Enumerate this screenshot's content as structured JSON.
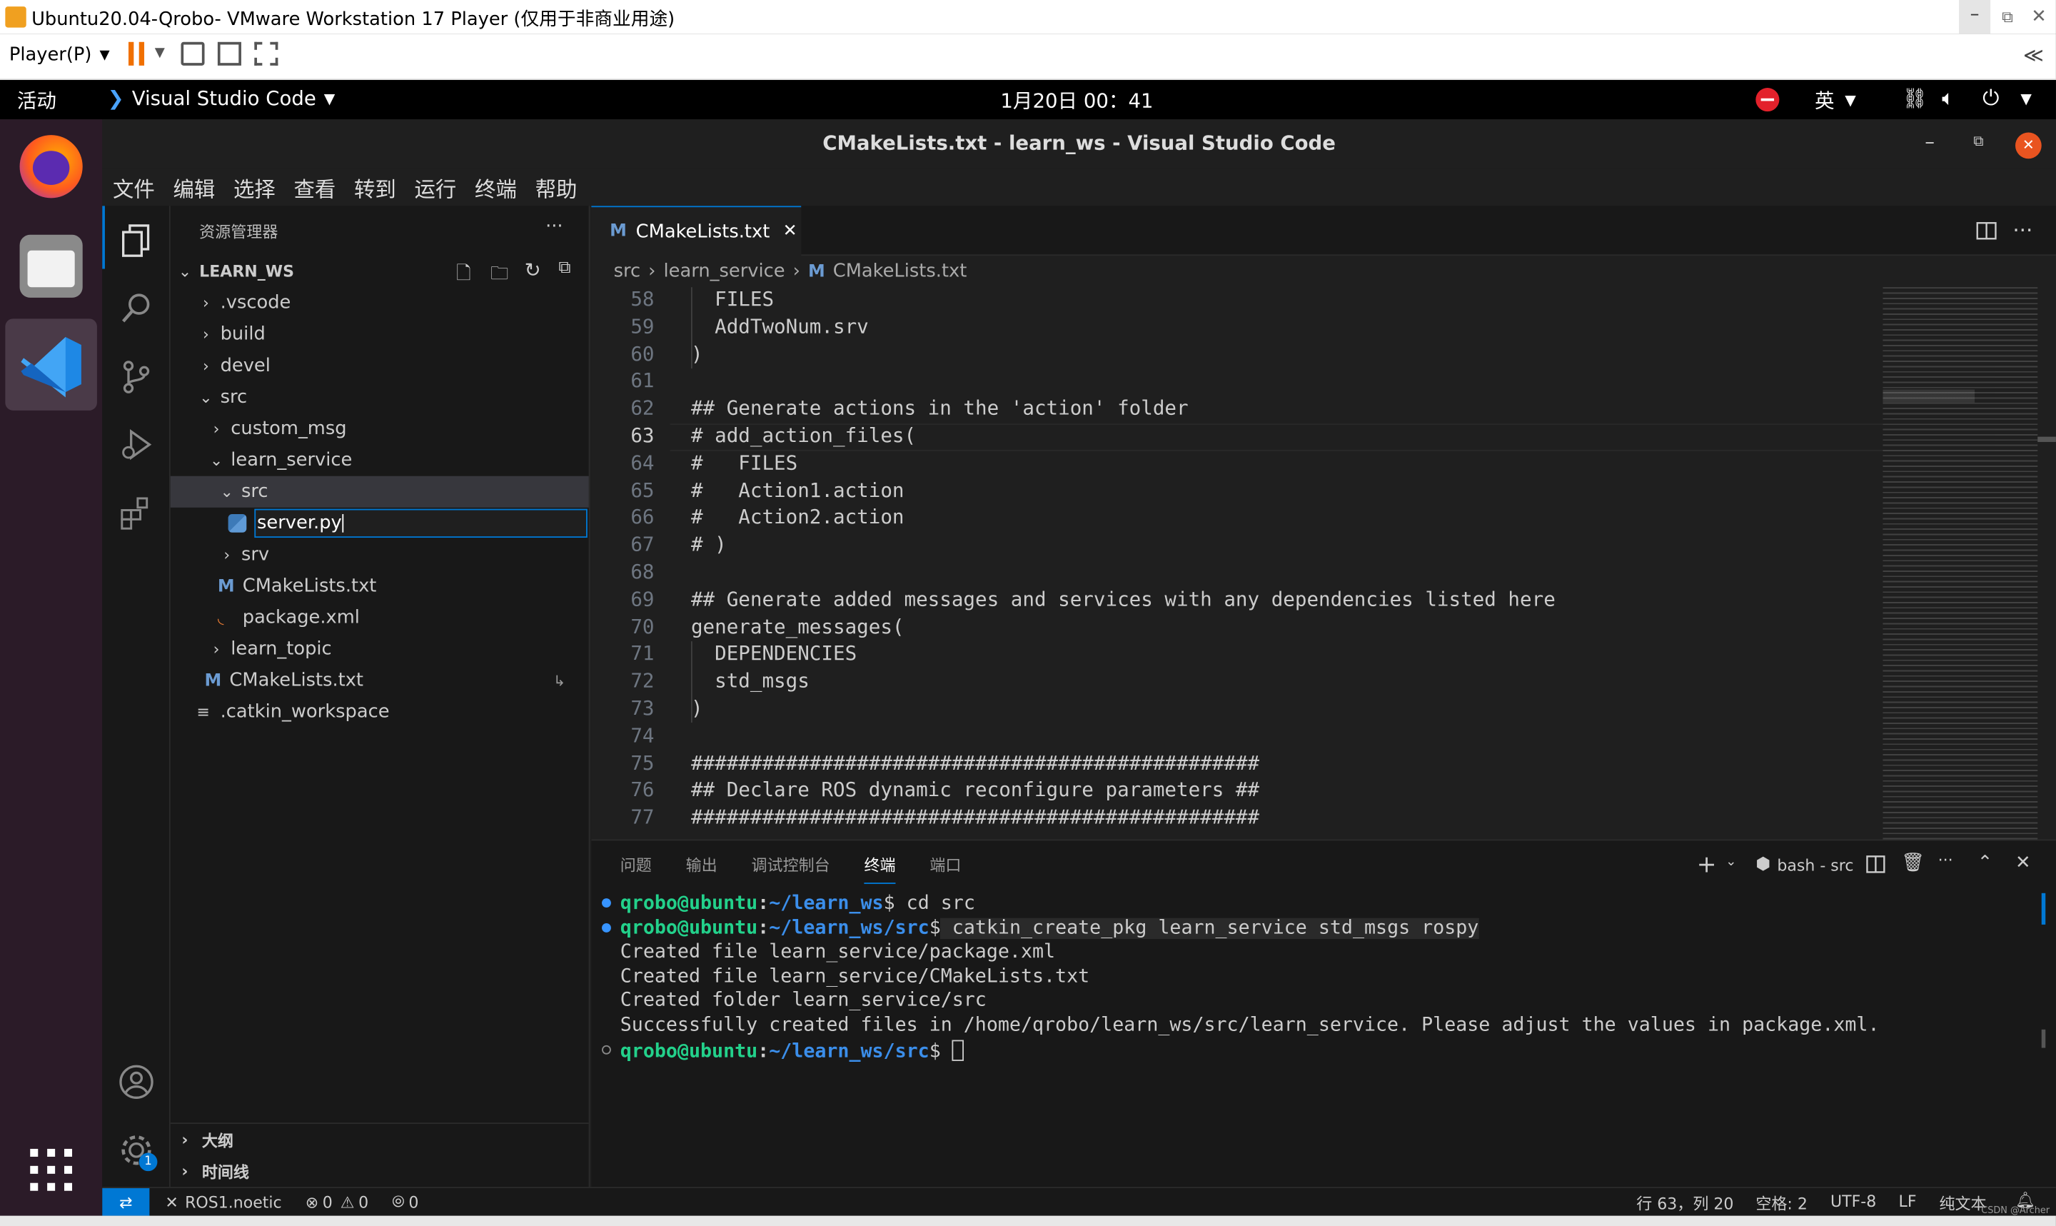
{
  "vm": {
    "title": "Ubuntu20.04-Qrobo- VMware Workstation 17 Player (仅用于非商业用途)",
    "player_menu": "Player(P)",
    "collapse_glyph": "≪"
  },
  "gnome": {
    "activities": "活动",
    "app_name": "Visual Studio Code",
    "clock": "1月20日  00：41",
    "input_method": "英"
  },
  "vscode": {
    "window_title": "CMakeLists.txt - learn_ws - Visual Studio Code",
    "menu": [
      "文件",
      "编辑",
      "选择",
      "查看",
      "转到",
      "运行",
      "终端",
      "帮助"
    ],
    "explorer": {
      "header": "资源管理器",
      "root": "LEARN_WS",
      "items": [
        ".vscode",
        "build",
        "devel",
        "src",
        "custom_msg",
        "learn_service",
        "src",
        "server.py",
        "srv",
        "CMakeLists.txt",
        "package.xml",
        "learn_topic",
        "CMakeLists.txt",
        ".catkin_workspace"
      ],
      "outline": "大纲",
      "timeline": "时间线"
    },
    "tab": {
      "badge": "M",
      "label": "CMakeLists.txt"
    },
    "breadcrumb": [
      "src",
      "learn_service",
      "CMakeLists.txt"
    ],
    "code_lines": [
      {
        "n": "58",
        "t": "  FILES"
      },
      {
        "n": "59",
        "t": "  AddTwoNum.srv"
      },
      {
        "n": "60",
        "t": ")"
      },
      {
        "n": "61",
        "t": ""
      },
      {
        "n": "62",
        "t": "## Generate actions in the 'action' folder"
      },
      {
        "n": "63",
        "t": "# add_action_files("
      },
      {
        "n": "64",
        "t": "#   FILES"
      },
      {
        "n": "65",
        "t": "#   Action1.action"
      },
      {
        "n": "66",
        "t": "#   Action2.action"
      },
      {
        "n": "67",
        "t": "# )"
      },
      {
        "n": "68",
        "t": ""
      },
      {
        "n": "69",
        "t": "## Generate added messages and services with any dependencies listed here"
      },
      {
        "n": "70",
        "t": "generate_messages("
      },
      {
        "n": "71",
        "t": "  DEPENDENCIES"
      },
      {
        "n": "72",
        "t": "  std_msgs"
      },
      {
        "n": "73",
        "t": ")"
      },
      {
        "n": "74",
        "t": ""
      },
      {
        "n": "75",
        "t": "################################################"
      },
      {
        "n": "76",
        "t": "## Declare ROS dynamic reconfigure parameters ##"
      },
      {
        "n": "77",
        "t": "################################################"
      }
    ],
    "panel_tabs": [
      "问题",
      "输出",
      "调试控制台",
      "终端",
      "端口"
    ],
    "terminal_label": "bash - src",
    "terminal": {
      "prompt_user": "qrobo@ubuntu",
      "line1_path": "~/learn_ws",
      "line1_cmd": " cd src",
      "line2_path": "~/learn_ws/src",
      "line2_cmd": " catkin_create_pkg learn_service std_msgs rospy",
      "out1": "Created file learn_service/package.xml",
      "out2": "Created file learn_service/CMakeLists.txt",
      "out3": "Created folder learn_service/src",
      "out4": "Successfully created files in /home/qrobo/learn_ws/src/learn_service. Please adjust the values in package.xml.",
      "line3_path": "~/learn_ws/src"
    },
    "status": {
      "remote": "ROS1.noetic",
      "errors": "0",
      "warnings": "0",
      "ports": "0",
      "position": "行 63，列 20",
      "spaces": "空格: 2",
      "encoding": "UTF-8",
      "eol": "LF",
      "language": "纯文本"
    },
    "watermark": "CSDN @Archer"
  }
}
